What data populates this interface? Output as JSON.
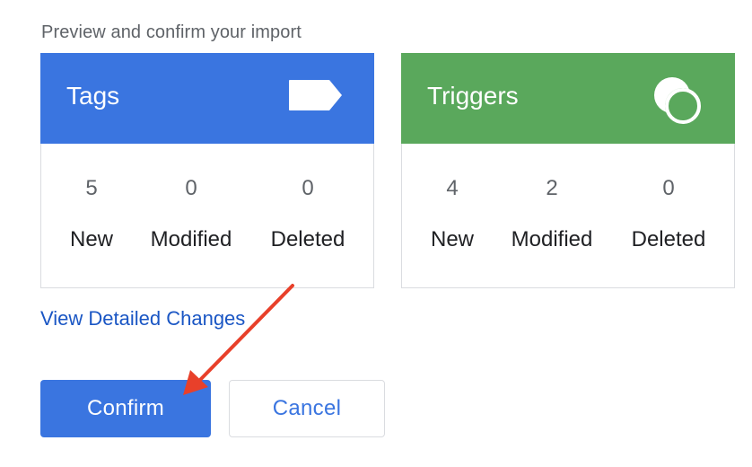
{
  "subtitle": "Preview and confirm your import",
  "cards": [
    {
      "title": "Tags",
      "icon": "tag-icon",
      "color": "#3a75e0",
      "stats": [
        {
          "value": "5",
          "label": "New"
        },
        {
          "value": "0",
          "label": "Modified"
        },
        {
          "value": "0",
          "label": "Deleted"
        }
      ]
    },
    {
      "title": "Triggers",
      "icon": "triggers-icon",
      "color": "#5aa85c",
      "stats": [
        {
          "value": "4",
          "label": "New"
        },
        {
          "value": "2",
          "label": "Modified"
        },
        {
          "value": "0",
          "label": "Deleted"
        }
      ]
    }
  ],
  "view_detailed_changes": "View Detailed Changes",
  "buttons": {
    "confirm": "Confirm",
    "cancel": "Cancel"
  },
  "colors": {
    "primary": "#3a75e0",
    "link": "#1a56c4",
    "annotation_arrow": "#e8402a"
  }
}
